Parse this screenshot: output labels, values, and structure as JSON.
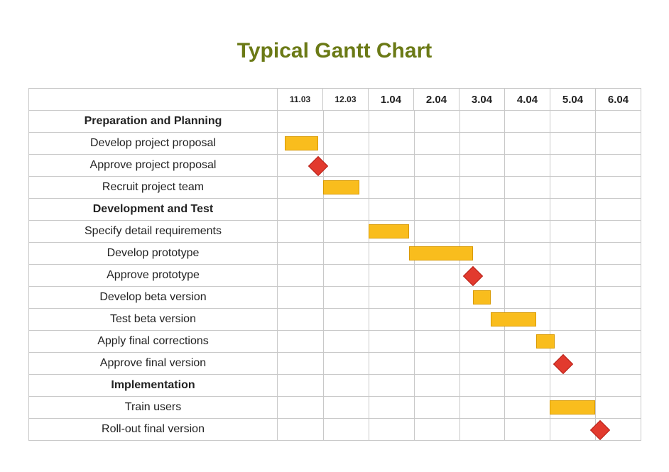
{
  "title": "Typical Gantt Chart",
  "chart_data": {
    "type": "gantt",
    "time_axis": [
      "11.03",
      "12.03",
      "1.04",
      "2.04",
      "3.04",
      "4.04",
      "5.04",
      "6.04"
    ],
    "time_axis_notes": "First two columns rendered with smaller font in source image",
    "xlim": [
      0,
      8
    ],
    "rows": [
      {
        "kind": "group",
        "label": "Preparation and Planning"
      },
      {
        "kind": "task",
        "label": "Develop project proposal",
        "start": 0.15,
        "end": 0.9
      },
      {
        "kind": "milestone",
        "label": "Approve project proposal",
        "at": 0.9
      },
      {
        "kind": "task",
        "label": "Recruit project team",
        "start": 1.0,
        "end": 1.8
      },
      {
        "kind": "group",
        "label": "Development and Test"
      },
      {
        "kind": "task",
        "label": "Specify detail requirements",
        "start": 2.0,
        "end": 2.9
      },
      {
        "kind": "task",
        "label": "Develop prototype",
        "start": 2.9,
        "end": 4.3
      },
      {
        "kind": "milestone",
        "label": "Approve prototype",
        "at": 4.3
      },
      {
        "kind": "task",
        "label": "Develop beta version",
        "start": 4.3,
        "end": 4.7
      },
      {
        "kind": "task",
        "label": "Test beta version",
        "start": 4.7,
        "end": 5.7
      },
      {
        "kind": "task",
        "label": "Apply final corrections",
        "start": 5.7,
        "end": 6.1
      },
      {
        "kind": "milestone",
        "label": "Approve final version",
        "at": 6.3
      },
      {
        "kind": "group",
        "label": "Implementation"
      },
      {
        "kind": "task",
        "label": "Train users",
        "start": 6.0,
        "end": 7.0
      },
      {
        "kind": "milestone",
        "label": "Roll-out final version",
        "at": 7.1
      }
    ],
    "colors": {
      "bar_fill": "#f9bd1d",
      "bar_border": "#d99a00",
      "milestone_fill": "#e23a2e",
      "milestone_border": "#b52017",
      "title_color": "#6b7a16",
      "grid_color": "#c8c8c8"
    }
  }
}
